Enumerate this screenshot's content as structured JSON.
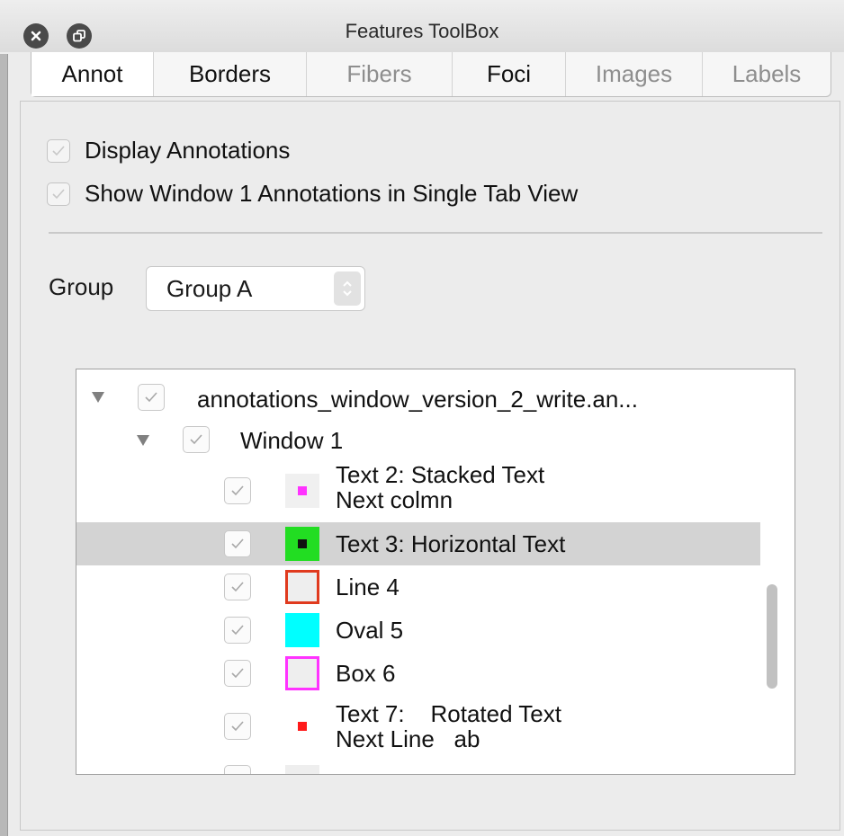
{
  "window": {
    "title": "Features ToolBox"
  },
  "tabs": [
    {
      "label": "Annot",
      "state": "active"
    },
    {
      "label": "Borders",
      "state": "enabled"
    },
    {
      "label": "Fibers",
      "state": "disabled"
    },
    {
      "label": "Foci",
      "state": "enabled"
    },
    {
      "label": "Images",
      "state": "disabled"
    },
    {
      "label": "Labels",
      "state": "disabled"
    }
  ],
  "options": {
    "display_annotations": {
      "label": "Display Annotations",
      "checked": true
    },
    "show_window_annotations": {
      "label": "Show Window 1 Annotations in Single Tab View",
      "checked": true
    }
  },
  "group": {
    "label": "Group",
    "selected": "Group A"
  },
  "tree": {
    "file": {
      "label": "annotations_window_version_2_write.an...",
      "checked": true,
      "expanded": true
    },
    "window": {
      "label": "Window 1",
      "checked": true,
      "expanded": true
    },
    "items": [
      {
        "line1": "Text 2: Stacked Text",
        "line2": "Next colmn",
        "checked": true,
        "swatch": {
          "fill": "#f0f0f0",
          "border": "none",
          "dot": "#ff33ff"
        }
      },
      {
        "line1": "Text 3: Horizontal Text",
        "line2": "",
        "checked": true,
        "selected": true,
        "swatch": {
          "fill": "#22dd22",
          "border": "none",
          "dot": "#111111"
        }
      },
      {
        "line1": "Line 4",
        "line2": "",
        "checked": true,
        "swatch": {
          "fill": "#eeeeee",
          "border": "#e03a1e",
          "dot": ""
        }
      },
      {
        "line1": "Oval 5",
        "line2": "",
        "checked": true,
        "swatch": {
          "fill": "#00ffff",
          "border": "none",
          "dot": ""
        }
      },
      {
        "line1": "Box 6",
        "line2": "",
        "checked": true,
        "swatch": {
          "fill": "#eeeeee",
          "border": "#ff33ff",
          "dot": ""
        }
      },
      {
        "line1": "Text 7:    Rotated Text",
        "line2": "Next Line   ab",
        "checked": true,
        "swatch": {
          "fill": "#ffffff",
          "border": "none",
          "dot": "#ff1a1a"
        }
      }
    ]
  }
}
